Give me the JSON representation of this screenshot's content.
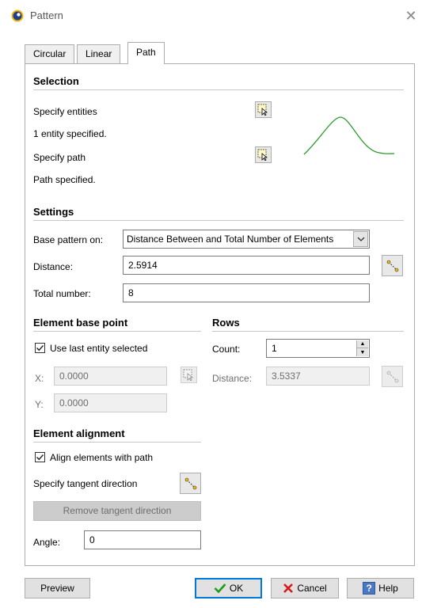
{
  "window": {
    "title": "Pattern",
    "close_glyph": "✕"
  },
  "tabs": [
    {
      "label": "Circular",
      "active": false
    },
    {
      "label": "Linear",
      "active": false
    },
    {
      "label": "Path",
      "active": true
    }
  ],
  "selection": {
    "title": "Selection",
    "specify_entities": "Specify entities",
    "entities_status": "1 entity specified.",
    "specify_path": "Specify path",
    "path_status": "Path specified.",
    "preview_curve_color": "#2e9b2e"
  },
  "settings": {
    "title": "Settings",
    "base_pattern_label": "Base pattern on:",
    "base_pattern_value": "Distance Between and Total Number of Elements",
    "distance_label": "Distance:",
    "distance_value": "2.5914",
    "total_number_label": "Total number:",
    "total_number_value": "8"
  },
  "base_point": {
    "title": "Element base point",
    "use_last_label": "Use last entity selected",
    "use_last_checked": true,
    "x_label": "X:",
    "x_value": "0.0000",
    "y_label": "Y:",
    "y_value": "0.0000"
  },
  "rows": {
    "title": "Rows",
    "count_label": "Count:",
    "count_value": "1",
    "distance_label": "Distance:",
    "distance_value": "3.5337"
  },
  "alignment": {
    "title": "Element alignment",
    "align_label": "Align elements with path",
    "align_checked": true,
    "tangent_label": "Specify tangent direction",
    "remove_tangent_label": "Remove tangent direction",
    "angle_label": "Angle:",
    "angle_value": "0"
  },
  "buttons": {
    "preview": "Preview",
    "ok": "OK",
    "cancel": "Cancel",
    "help": "Help"
  },
  "colors": {
    "ok_check": "#1d9b1d",
    "cancel_x": "#d71a1a",
    "help_bg": "#4a78c2",
    "default_border": "#0078d7"
  }
}
